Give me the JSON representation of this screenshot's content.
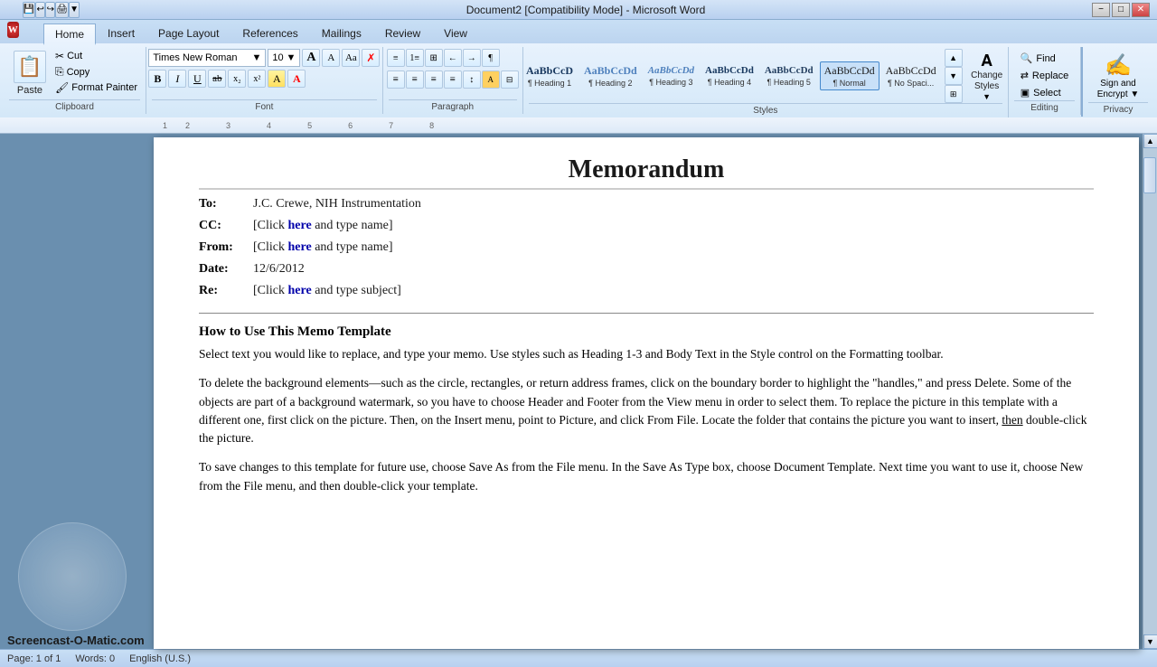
{
  "titlebar": {
    "title": "Document2 [Compatibility Mode] - Microsoft Word",
    "minimize": "−",
    "restore": "□",
    "close": "✕"
  },
  "ribbon": {
    "tabs": [
      "Home",
      "Insert",
      "Page Layout",
      "References",
      "Mailings",
      "Review",
      "View"
    ],
    "active_tab": "Home",
    "groups": {
      "clipboard": {
        "label": "Clipboard",
        "paste": "Paste",
        "cut": "Cut",
        "copy": "Copy",
        "format_painter": "Format Painter"
      },
      "font": {
        "label": "Font",
        "font_name": "Times New Roman",
        "font_size": "10",
        "bold": "B",
        "italic": "I",
        "underline": "U",
        "strikethrough": "ab",
        "subscript": "x₂",
        "superscript": "x²",
        "clear": "A",
        "highlight": "A",
        "color": "A"
      },
      "paragraph": {
        "label": "Paragraph"
      },
      "styles": {
        "label": "Styles",
        "items": [
          {
            "name": "heading1",
            "preview": "AaBbCcD",
            "label": "¶ Heading 1"
          },
          {
            "name": "heading2",
            "preview": "AaBbCcDd",
            "label": "¶ Heading 2"
          },
          {
            "name": "heading3",
            "preview": "AaBbCcDd",
            "label": "¶ Heading 3"
          },
          {
            "name": "heading4",
            "preview": "AaBbCcDd",
            "label": "¶ Heading 4"
          },
          {
            "name": "heading5",
            "preview": "AaBbCcDd",
            "label": "¶ Heading 5"
          },
          {
            "name": "normal",
            "preview": "AaBbCcDd",
            "label": "¶ Normal"
          },
          {
            "name": "nospacing",
            "preview": "AaBbCcDd",
            "label": "¶ No Spaci..."
          }
        ],
        "change_styles": "Change\nStyles"
      },
      "editing": {
        "label": "Editing",
        "find": "Find",
        "replace": "Replace",
        "select": "Select"
      },
      "privacy": {
        "sign_label": "Sign and\nEncrypt -",
        "privacy_label": "Privacy"
      }
    }
  },
  "document": {
    "title": "Memorandum",
    "to_label": "To:",
    "to_value": "J.C. Crewe, NIH Instrumentation",
    "cc_label": "CC:",
    "cc_value": "[Click here and type name]",
    "cc_here": "here",
    "from_label": "From:",
    "from_value": "[Click here and type name]",
    "from_here": "here",
    "date_label": "Date:",
    "date_value": "12/6/2012",
    "re_label": "Re:",
    "re_value": "[Click here and type subject]",
    "re_here": "here",
    "body_heading": "How to Use This Memo Template",
    "body_p1": "Select text you would like to replace, and type your memo. Use styles such as Heading 1-3 and Body Text in the Style control on the Formatting toolbar.",
    "body_p2": "To delete the background elements—such as the circle, rectangles, or return address frames, click on the boundary border to highlight the \"handles,\" and press Delete. Some of the objects are part of a background watermark, so you have to choose Header and Footer from the View menu in order to select them. To replace the picture in this template with a different one, first click on the picture. Then, on the Insert menu, point to Picture, and click From File. Locate the folder that contains the picture you want to insert, then double-click the picture.",
    "body_p3": "To save changes to this template for future use, choose Save As from the File menu. In the Save As Type box, choose Document Template. Next time you want to use it, choose New from the File menu, and then double-click your template.",
    "body_p2_then": "then"
  },
  "statusbar": {
    "page": "Page: 1 of 1",
    "words": "Words: 0",
    "language": "English (U.S.)"
  },
  "watermark": "Screencast-O-Matic.com"
}
